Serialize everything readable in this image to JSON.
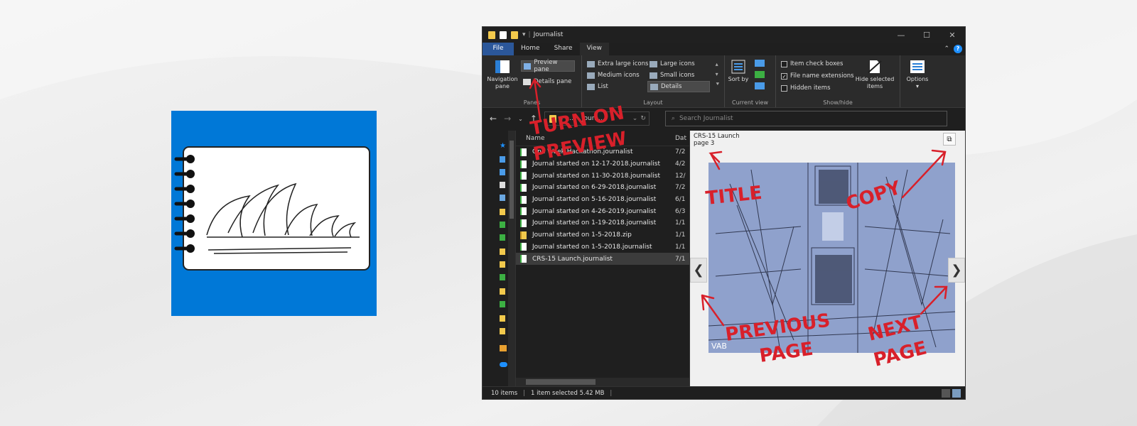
{
  "window": {
    "title": "Journalist",
    "controls": [
      "—",
      "☐",
      "✕"
    ]
  },
  "tabs": [
    "File",
    "Home",
    "Share",
    "View"
  ],
  "ribbon": {
    "panes": {
      "navigation": "Navigation pane",
      "preview": "Preview pane",
      "details": "Details pane",
      "group_label": "Panes"
    },
    "layout": {
      "options": [
        "Extra large icons",
        "Large icons",
        "Medium icons",
        "Small icons",
        "List",
        "Details"
      ],
      "selected": "Details",
      "group_label": "Layout"
    },
    "current_view": {
      "sort": "Sort by",
      "group_label": "Current view"
    },
    "show_hide": {
      "item_check_boxes": "Item check boxes",
      "file_name_extensions": "File name extensions",
      "hidden_items": "Hidden items",
      "hide_selected": "Hide selected items",
      "group_label": "Show/hide",
      "file_name_extensions_checked": true
    },
    "options": "Options"
  },
  "address": {
    "breadcrumb": "« p... › Journ...",
    "search_placeholder": "Search Journalist"
  },
  "columns": {
    "name": "Name",
    "date": "Dat"
  },
  "files": [
    {
      "name": "One Week Hackathon.journalist",
      "date": "7/2",
      "type": "journal"
    },
    {
      "name": "Journal started on 12-17-2018.journalist",
      "date": "4/2",
      "type": "journal"
    },
    {
      "name": "Journal started on 11-30-2018.journalist",
      "date": "12/",
      "type": "journal"
    },
    {
      "name": "Journal started on 6-29-2018.journalist",
      "date": "7/2",
      "type": "journal"
    },
    {
      "name": "Journal started on 5-16-2018.journalist",
      "date": "6/1",
      "type": "journal"
    },
    {
      "name": "Journal started on 4-26-2019.journalist",
      "date": "6/3",
      "type": "journal"
    },
    {
      "name": "Journal started on 1-19-2018.journalist",
      "date": "1/1",
      "type": "journal"
    },
    {
      "name": "Journal started on 1-5-2018.zip",
      "date": "1/1",
      "type": "zip"
    },
    {
      "name": "Journal started on 1-5-2018.journalist",
      "date": "1/1",
      "type": "journal"
    },
    {
      "name": "CRS-15 Launch.journalist",
      "date": "7/1",
      "type": "journal",
      "selected": true
    }
  ],
  "preview": {
    "title_line1": "CRS-15 Launch",
    "title_line2": "page 3",
    "signature": "VAB",
    "prev_glyph": "❮",
    "next_glyph": "❯",
    "copy_glyph": "⧉"
  },
  "status": {
    "items": "10 items",
    "selected": "1 item selected  5.42 MB"
  },
  "annotations": {
    "turn_on": "TURN ON",
    "preview": "PREVIEW",
    "title": "TITLE",
    "copy": "COPY",
    "previous": "PREVIOUS",
    "page_left": "PAGE",
    "next": "NEXT",
    "page_right": "PAGE"
  },
  "colors": {
    "accent_blue": "#0078d7",
    "file_tab": "#2b579a",
    "annotation_red": "#d8202a",
    "sketch_bg": "#8fa1cc"
  }
}
